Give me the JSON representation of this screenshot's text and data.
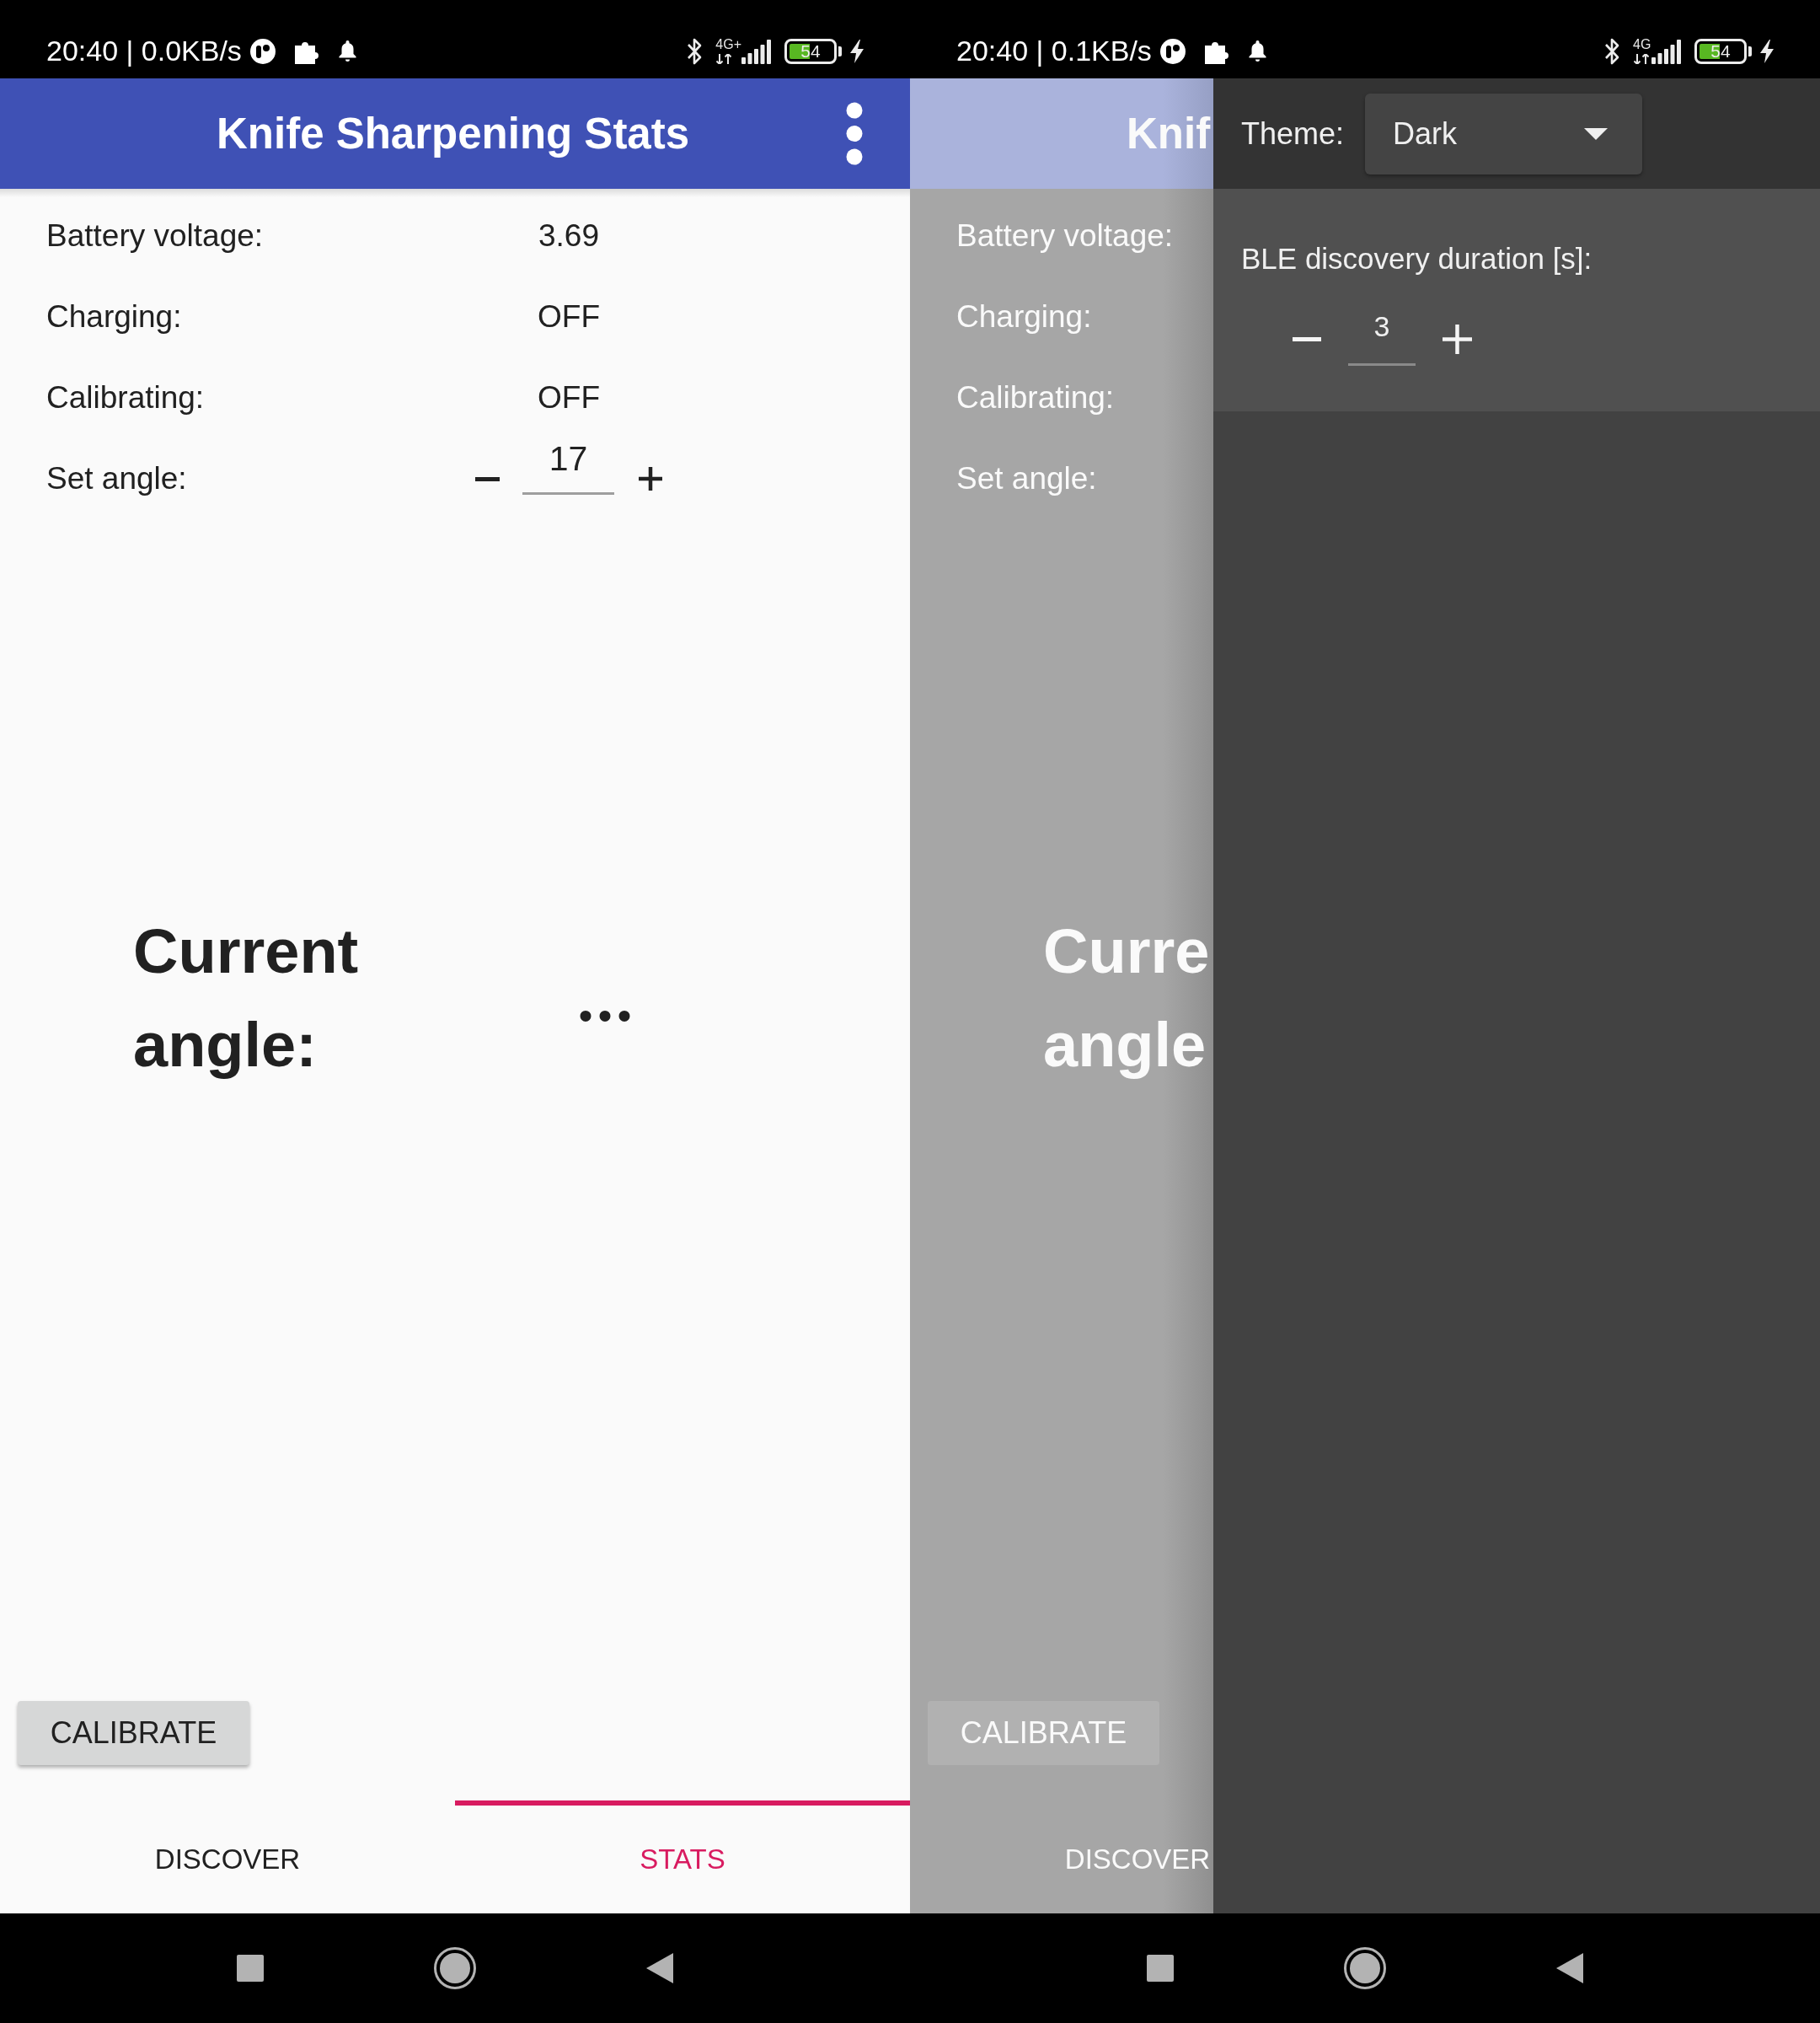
{
  "screens": [
    {
      "status_bar": {
        "status_text": "20:40 | 0.0KB/s",
        "network_type": "4G+",
        "battery_percent": "54"
      },
      "app_bar": {
        "title": "Knife Sharpening Stats"
      },
      "stats": [
        {
          "label": "Battery voltage:",
          "value": "3.69",
          "kind": "reading"
        },
        {
          "label": "Charging:",
          "value": "OFF",
          "kind": "reading"
        },
        {
          "label": "Calibrating:",
          "value": "OFF",
          "kind": "reading"
        },
        {
          "label": "Set angle:",
          "value": "17",
          "kind": "stepper"
        }
      ],
      "current_angle": {
        "label": "Current angle:",
        "value": "..."
      },
      "calibrate_button": "CALIBRATE",
      "tabs": [
        {
          "label": "DISCOVER",
          "selected": false
        },
        {
          "label": "STATS",
          "selected": true
        }
      ]
    },
    {
      "status_bar": {
        "status_text": "20:40 | 0.1KB/s",
        "network_type": "4G",
        "battery_percent": "54"
      },
      "app_bar": {
        "title": "Knif"
      },
      "stats": [
        {
          "label": "Battery voltage:"
        },
        {
          "label": "Charging:"
        },
        {
          "label": "Calibrating:"
        },
        {
          "label": "Set angle:"
        }
      ],
      "current_angle": {
        "label": "Curre angle"
      },
      "calibrate_button": "CALIBRATE",
      "tabs": [
        {
          "label": "DISCOVER",
          "selected": false
        }
      ],
      "drawer": {
        "theme": {
          "label": "Theme:",
          "value": "Dark"
        },
        "ble_discovery_duration": {
          "label": "BLE discovery duration [s]:",
          "value": "3"
        }
      }
    }
  ]
}
